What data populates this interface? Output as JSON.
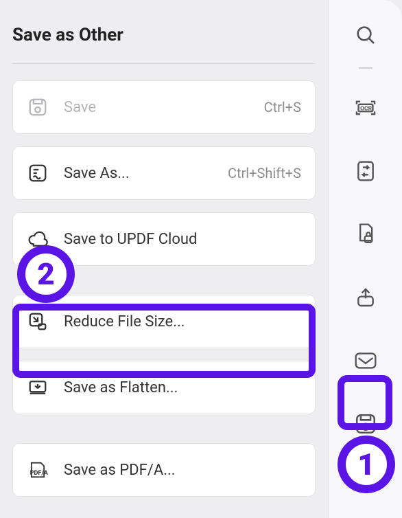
{
  "panel": {
    "title": "Save as Other",
    "items": [
      {
        "label": "Save",
        "shortcut": "Ctrl+S",
        "muted": true
      },
      {
        "label": "Save As...",
        "shortcut": "Ctrl+Shift+S"
      },
      {
        "label": "Save to UPDF Cloud",
        "shortcut": ""
      },
      {
        "label": "Reduce File Size...",
        "shortcut": ""
      },
      {
        "label": "Save as Flatten...",
        "shortcut": ""
      },
      {
        "label": "Save as PDF/A...",
        "shortcut": ""
      }
    ]
  },
  "annotations": {
    "badge1": "1",
    "badge2": "2"
  },
  "sidebar_icons": [
    "search-icon",
    "ocr-icon",
    "convert-icon",
    "protect-icon",
    "share-icon",
    "mail-icon",
    "save-icon",
    "more-icon"
  ]
}
